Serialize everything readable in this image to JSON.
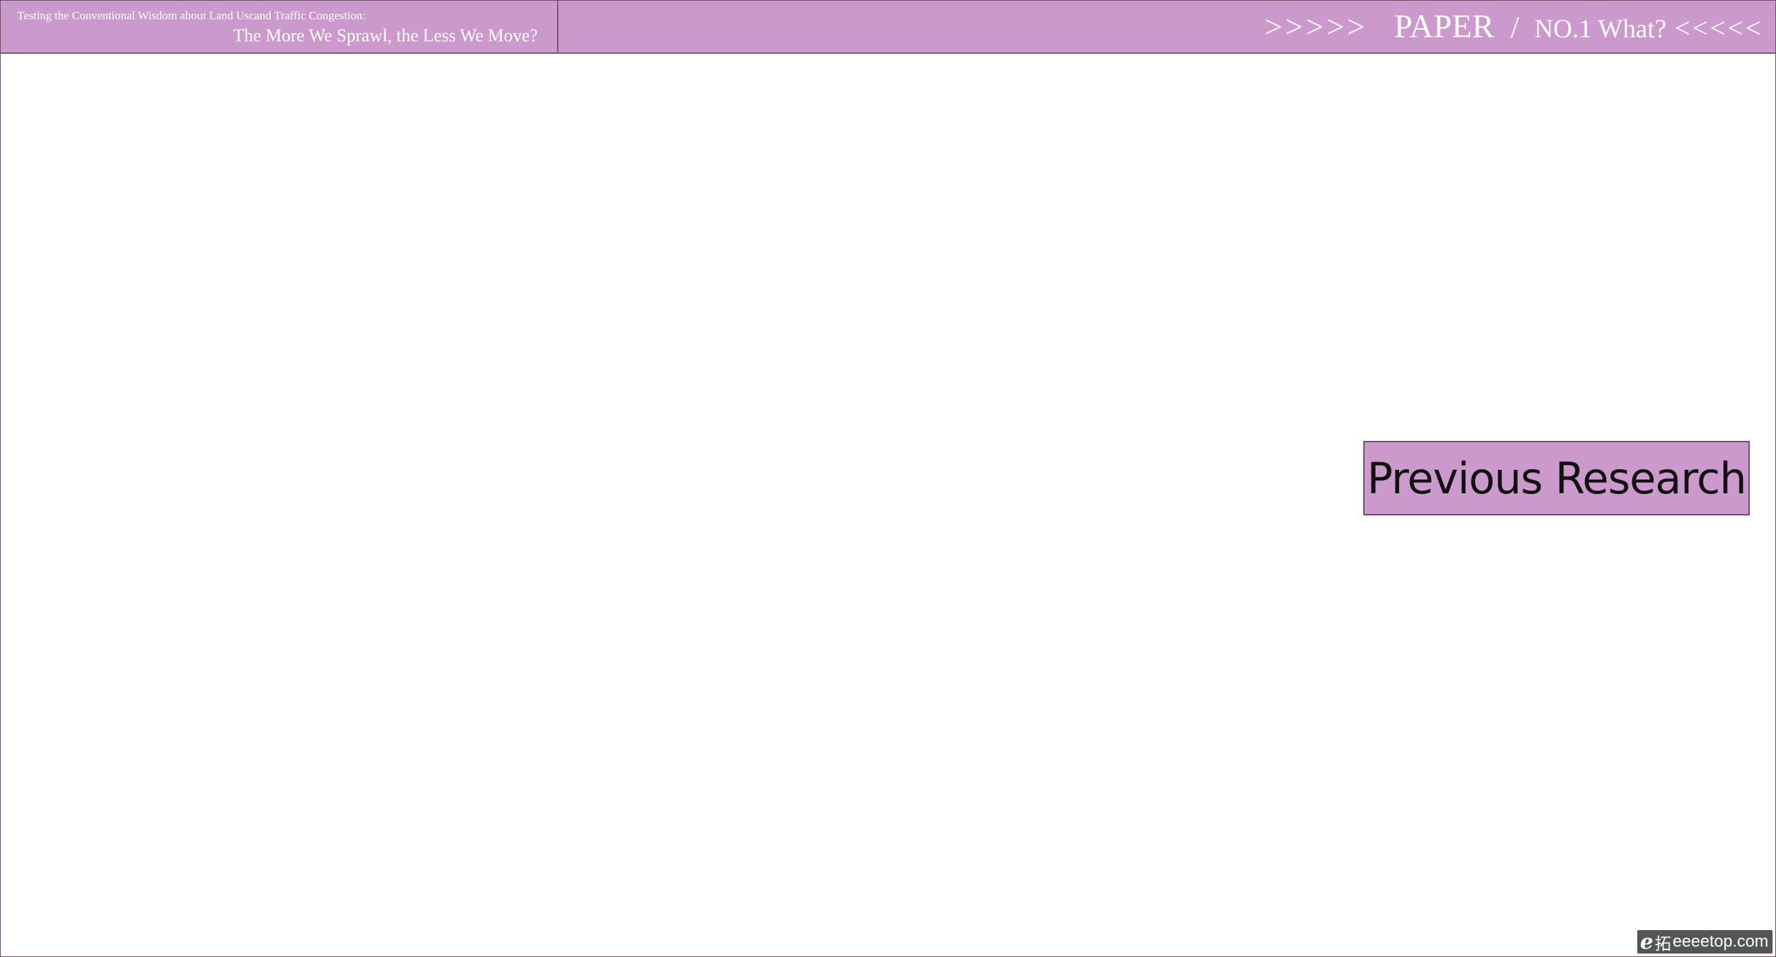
{
  "header": {
    "subtitle": "Testing the Conventional Wisdom about Land Uscand Traffic Congestion:",
    "title": "The More We Sprawl, the Less We Move?",
    "nav": {
      "arrows_left": ">>>>>",
      "paper": "PAPER",
      "slash": "/",
      "section": "NO.1 What?",
      "arrows_right": "<<<<<"
    }
  },
  "main": {
    "button_label": "Previous Research"
  },
  "watermark": {
    "logo": "e",
    "char": "拓",
    "text": "eeeetop.com"
  },
  "colors": {
    "accent": "#cc99cc",
    "border": "#7a5a77",
    "header_text": "#ffffff",
    "button_text": "#111111"
  }
}
